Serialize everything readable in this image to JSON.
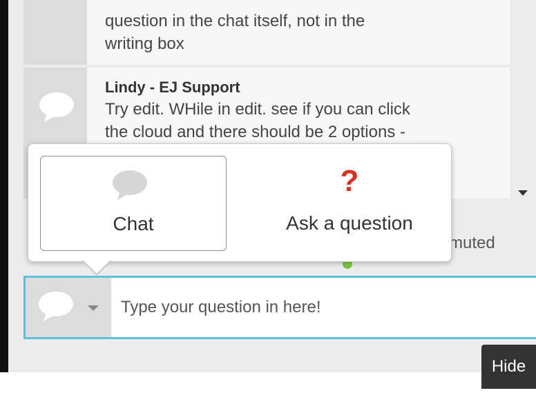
{
  "messages": [
    {
      "author": "",
      "text_lines": [
        "question in the chat itself, not in the",
        "writing box"
      ]
    },
    {
      "author": "Lindy - EJ Support",
      "text_lines": [
        "Try edit. WHile in edit. see if you can click",
        "the cloud and there should be 2 options -"
      ]
    }
  ],
  "status": {
    "muted_text": "muted"
  },
  "type_menu": {
    "chat_label": "Chat",
    "ask_label": "Ask a question",
    "ask_icon": "?"
  },
  "composer": {
    "placeholder": "Type your question in here!",
    "value": ""
  },
  "hide_label": "Hide",
  "icons": {
    "chat": "speech-bubble-icon",
    "question": "question-mark-icon",
    "dropdown": "caret-down-icon",
    "scroll": "scroll-down-arrow-icon"
  },
  "colors": {
    "accent_border": "#5bc0de",
    "question_red": "#d9301f",
    "status_green": "#7ac943",
    "hide_bg": "#333333"
  }
}
